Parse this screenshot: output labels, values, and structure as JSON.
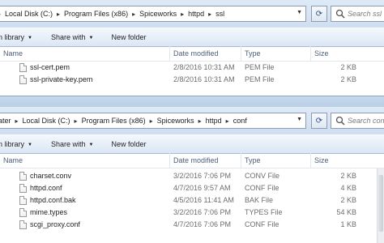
{
  "windows": [
    {
      "address": [
        "Local Disk (C:)",
        "Program Files (x86)",
        "Spiceworks",
        "httpd",
        "ssl"
      ],
      "search_placeholder": "Search ssl",
      "toolbar": {
        "include_label": "in library",
        "share_label": "Share with",
        "new_folder_label": "New folder"
      },
      "columns": {
        "name": "Name",
        "date": "Date modified",
        "type": "Type",
        "size": "Size"
      },
      "files": [
        {
          "name": "ssl-cert.pem",
          "date": "2/8/2016 10:31 AM",
          "type": "PEM File",
          "size": "2 KB"
        },
        {
          "name": "ssl-private-key.pem",
          "date": "2/8/2016 10:31 AM",
          "type": "PEM File",
          "size": "2 KB"
        }
      ]
    },
    {
      "address_prefix": "ater",
      "address": [
        "Local Disk (C:)",
        "Program Files (x86)",
        "Spiceworks",
        "httpd",
        "conf"
      ],
      "search_placeholder": "Search conf",
      "toolbar": {
        "include_label": "in library",
        "share_label": "Share with",
        "new_folder_label": "New folder"
      },
      "columns": {
        "name": "Name",
        "date": "Date modified",
        "type": "Type",
        "size": "Size"
      },
      "files": [
        {
          "name": "charset.conv",
          "date": "3/2/2016 7:06 PM",
          "type": "CONV File",
          "size": "2 KB"
        },
        {
          "name": "httpd.conf",
          "date": "4/7/2016 9:57 AM",
          "type": "CONF File",
          "size": "4 KB"
        },
        {
          "name": "httpd.conf.bak",
          "date": "4/5/2016 11:41 AM",
          "type": "BAK File",
          "size": "2 KB"
        },
        {
          "name": "mime.types",
          "date": "3/2/2016 7:06 PM",
          "type": "TYPES File",
          "size": "54 KB"
        },
        {
          "name": "scgi_proxy.conf",
          "date": "4/7/2016 7:06 PM",
          "type": "CONF File",
          "size": "1 KB"
        }
      ]
    }
  ]
}
